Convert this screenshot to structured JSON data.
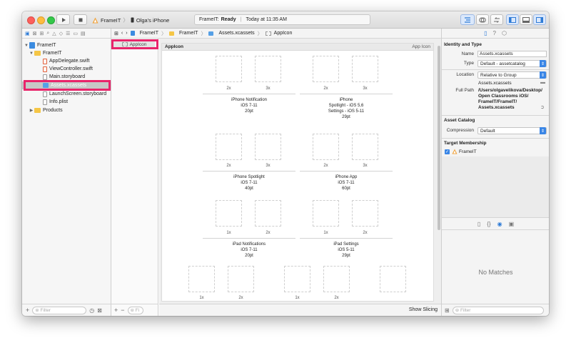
{
  "window": {
    "scheme_target": "FrameIT",
    "device": "Olga's iPhone",
    "status_app": "FrameIT:",
    "status_state": "Ready",
    "status_time": "Today at 11:35 AM"
  },
  "navigator": {
    "items": [
      {
        "label": "FrameIT",
        "kind": "project",
        "disclosure": "▼"
      },
      {
        "label": "FrameIT",
        "kind": "folder",
        "disclosure": "▼"
      },
      {
        "label": "AppDelegate.swift",
        "kind": "swift"
      },
      {
        "label": "ViewController.swift",
        "kind": "swift"
      },
      {
        "label": "Main.storyboard",
        "kind": "file"
      },
      {
        "label": "Assets.xcassets",
        "kind": "asset",
        "selected": true
      },
      {
        "label": "LaunchScreen.storyboard",
        "kind": "file"
      },
      {
        "label": "Info.plist",
        "kind": "file"
      },
      {
        "label": "Products",
        "kind": "folder",
        "disclosure": "▶"
      }
    ],
    "filter_placeholder": "Filter"
  },
  "jumpbar": {
    "crumbs": [
      "FrameIT",
      "FrameIT",
      "Assets.xcassets",
      "AppIcon"
    ]
  },
  "asset_list": {
    "selected": "AppIcon",
    "filter_placeholder": "Fi"
  },
  "editor": {
    "asset_name": "AppIcon",
    "asset_type": "App Icon",
    "groups": [
      {
        "line1": "iPhone Notification",
        "line2": "iOS 7-11",
        "line3": "20pt",
        "scales": [
          "2x",
          "3x"
        ]
      },
      {
        "line1": "iPhone",
        "line2": "Spotlight - iOS 5,6",
        "line3": "Settings - iOS 5-11",
        "line4": "29pt",
        "scales": [
          "2x",
          "3x"
        ]
      },
      {
        "line1": "iPhone Spotlight",
        "line2": "iOS 7-11",
        "line3": "40pt",
        "scales": [
          "2x",
          "3x"
        ]
      },
      {
        "line1": "iPhone App",
        "line2": "iOS 7-11",
        "line3": "60pt",
        "scales": [
          "2x",
          "3x"
        ]
      },
      {
        "line1": "iPad Notifications",
        "line2": "iOS 7-11",
        "line3": "20pt",
        "scales": [
          "1x",
          "2x"
        ]
      },
      {
        "line1": "iPad Settings",
        "line2": "iOS 5-11",
        "line3": "29pt",
        "scales": [
          "1x",
          "2x"
        ]
      }
    ],
    "bottom_row_scales": [
      "1x",
      "2x",
      "1x",
      "2x"
    ],
    "show_slicing": "Show Slicing"
  },
  "inspector": {
    "identity_title": "Identity and Type",
    "name_label": "Name",
    "name_value": "Assets.xcassets",
    "type_label": "Type",
    "type_value": "Default - assetcatalog",
    "location_label": "Location",
    "location_value": "Relative to Group",
    "location_file": "Assets.xcassets",
    "fullpath_label": "Full Path",
    "fullpath_value": "/Users/olgavelikova/Desktop/\nOpen Classrooms iOS/\nFrameIT/FrameIT/\nAssets.xcassets",
    "catalog_title": "Asset Catalog",
    "compression_label": "Compression",
    "compression_value": "Default",
    "membership_title": "Target Membership",
    "membership_target": "FrameIT",
    "no_matches": "No Matches",
    "filter_placeholder": "Filter"
  }
}
